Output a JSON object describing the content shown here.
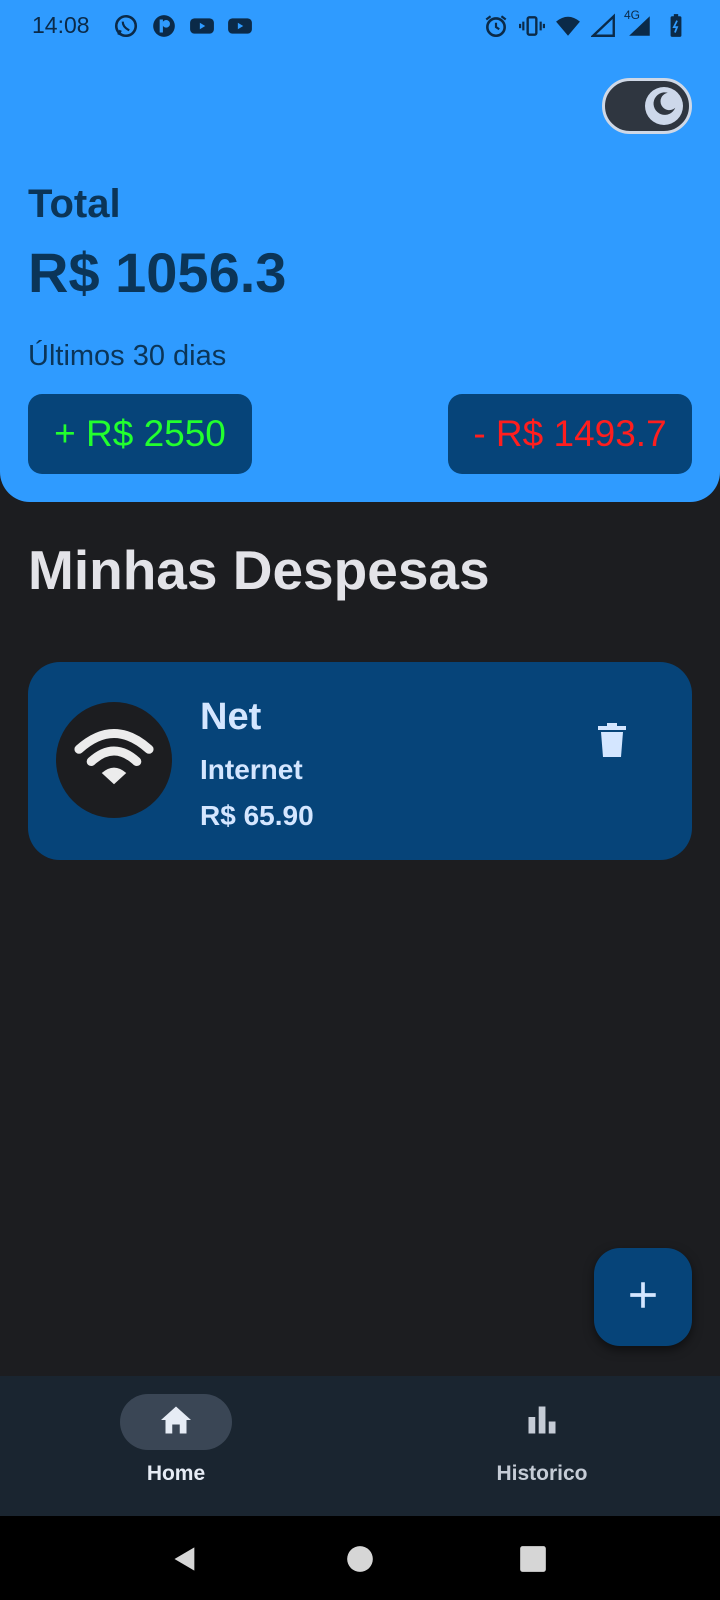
{
  "status_bar": {
    "time": "14:08",
    "left_icons": [
      "whatsapp-icon",
      "app-icon",
      "youtube-icon",
      "youtube-icon"
    ],
    "right_icons": [
      "alarm-icon",
      "vibrate-icon",
      "wifi-icon",
      "signal-icon",
      "signal-4g-icon",
      "battery-icon"
    ],
    "network_label": "4G"
  },
  "header": {
    "theme_toggle_icon": "moon-icon",
    "total_label": "Total",
    "total_value": "R$ 1056.3",
    "period_label": "Últimos 30 dias",
    "income": "+ R$ 2550",
    "expense": "- R$ 1493.7"
  },
  "colors": {
    "header_bg": "#2f9bff",
    "card_bg": "#064479",
    "app_bg": "#1c1d20",
    "income_text": "#22ff2e",
    "expense_text": "#ff1e1e"
  },
  "section": {
    "title": "Minhas Despesas"
  },
  "expenses": [
    {
      "icon": "wifi-icon",
      "name": "Net",
      "category": "Internet",
      "amount": "R$ 65.90",
      "action_icon": "trash-icon"
    }
  ],
  "fab": {
    "icon": "plus-icon"
  },
  "bottom_nav": {
    "items": [
      {
        "label": "Home",
        "icon": "home-icon",
        "active": true
      },
      {
        "label": "Historico",
        "icon": "bar-chart-icon",
        "active": false
      }
    ]
  },
  "system_nav": {
    "buttons": [
      "back-icon",
      "home-circle-icon",
      "recents-icon"
    ]
  }
}
